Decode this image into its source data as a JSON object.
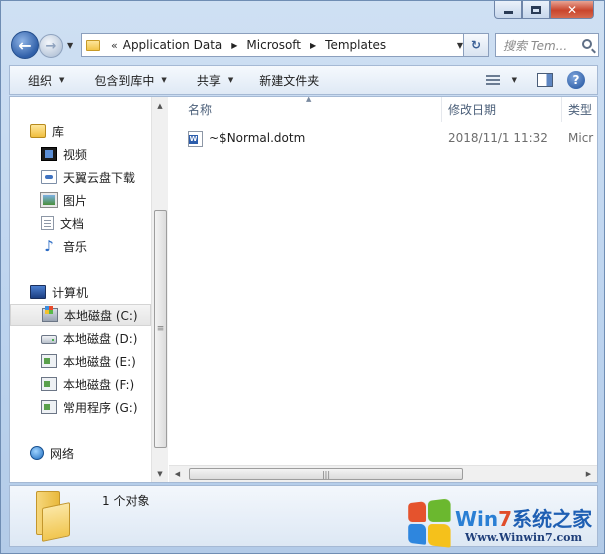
{
  "window": {
    "address": {
      "chevron": "«",
      "items": [
        "Application Data",
        "Microsoft",
        "Templates"
      ]
    },
    "search": {
      "placeholder": "搜索 Tem..."
    },
    "back_glyph": "←",
    "forward_glyph": "→",
    "refresh_glyph": "↻",
    "help_glyph": "?"
  },
  "toolbar": {
    "organize": "组织",
    "include_library": "包含到库中",
    "share": "共享",
    "new_folder": "新建文件夹"
  },
  "nav": {
    "libraries": "库",
    "library_items": [
      "视频",
      "天翼云盘下载",
      "图片",
      "文档",
      "音乐"
    ],
    "computer": "计算机",
    "drives": [
      "本地磁盘 (C:)",
      "本地磁盘 (D:)",
      "本地磁盘 (E:)",
      "本地磁盘 (F:)",
      "常用程序 (G:)"
    ],
    "selected_drive_index": 0,
    "network": "网络"
  },
  "files": {
    "columns": {
      "name": "名称",
      "date": "修改日期",
      "type": "类型"
    },
    "rows": [
      {
        "name": "~$Normal.dotm",
        "date": "2018/11/1 11:32",
        "type": "Micr"
      }
    ]
  },
  "details": {
    "status": "1 个对象"
  },
  "watermark": {
    "brand_a": "Win",
    "brand_7": "7",
    "brand_b": "系统之家",
    "url": "Www.Winwin7.com"
  },
  "colors": {
    "accent": "#2b5cab",
    "selection": "#e5e5e5",
    "frame": "#bcd3ee"
  }
}
